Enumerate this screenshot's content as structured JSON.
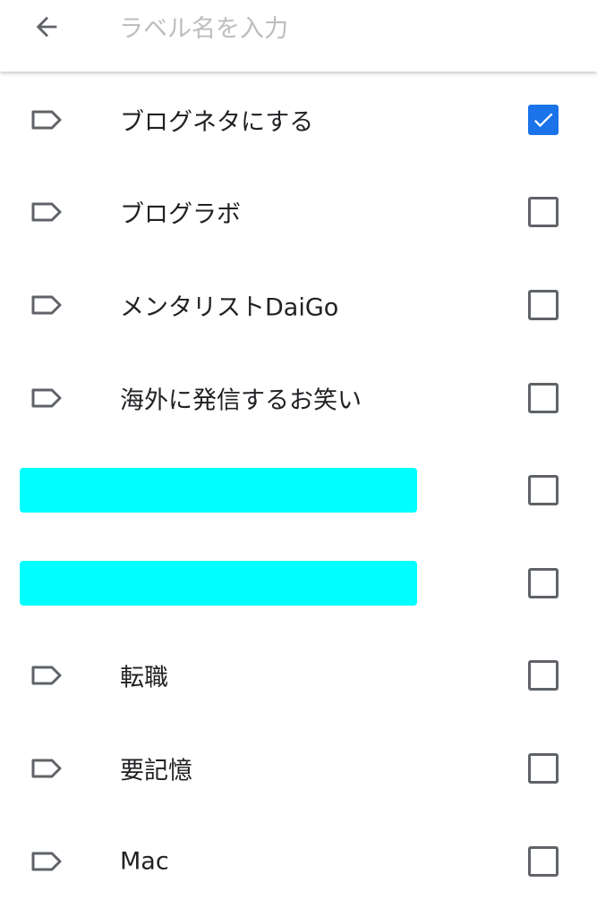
{
  "search": {
    "placeholder": "ラベル名を入力"
  },
  "icons": {
    "back": "arrow-back-icon",
    "label": "label-outline-icon",
    "checkbox_checked": "check-icon"
  },
  "colors": {
    "checkbox_checked": "#1a73e8",
    "redaction": "#00ffff"
  },
  "labels": [
    {
      "label": "ブログネタにする",
      "checked": true,
      "redacted": false
    },
    {
      "label": "ブログラボ",
      "checked": false,
      "redacted": false
    },
    {
      "label": "メンタリストDaiGo",
      "checked": false,
      "redacted": false
    },
    {
      "label": "海外に発信するお笑い",
      "checked": false,
      "redacted": false
    },
    {
      "label": "",
      "checked": false,
      "redacted": true
    },
    {
      "label": "",
      "checked": false,
      "redacted": true
    },
    {
      "label": "転職",
      "checked": false,
      "redacted": false
    },
    {
      "label": "要記憶",
      "checked": false,
      "redacted": false
    },
    {
      "label": "Mac",
      "checked": false,
      "redacted": false
    }
  ]
}
